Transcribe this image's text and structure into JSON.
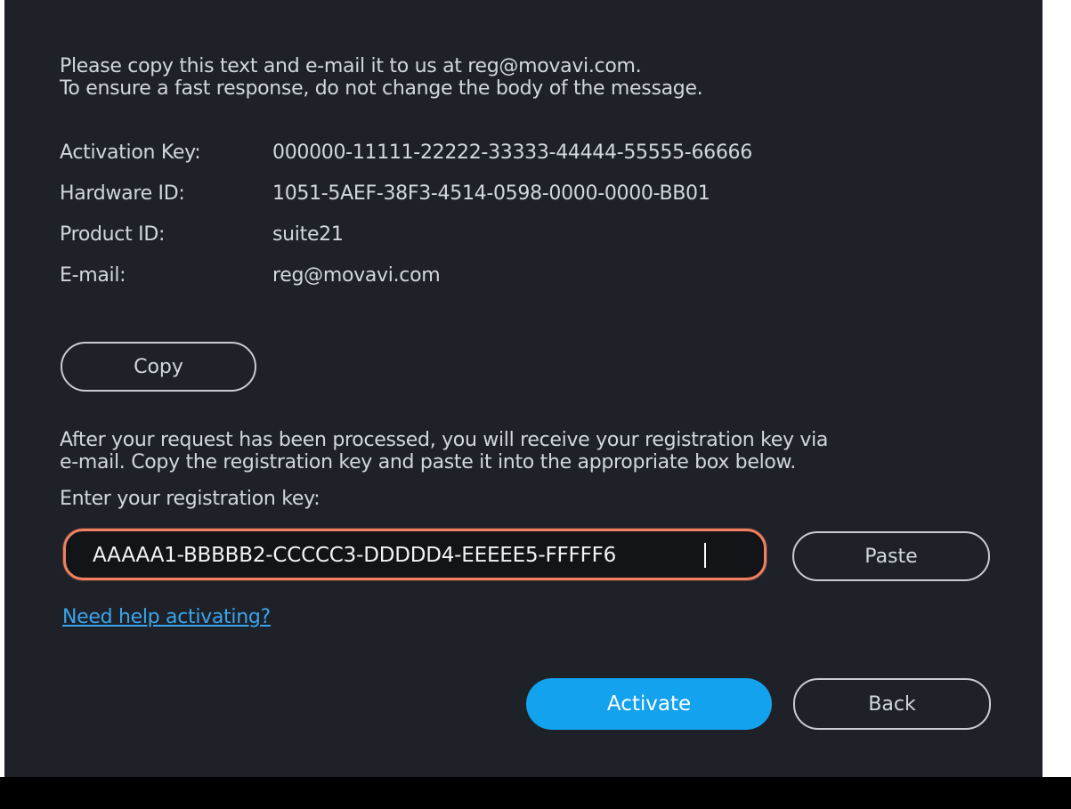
{
  "intro": {
    "line1": "Please copy this text and e-mail it to us at reg@movavi.com.",
    "line2": "To ensure a fast response, do not change the body of the message."
  },
  "details": [
    {
      "label": "Activation Key:",
      "value": "000000-11111-22222-33333-44444-55555-66666"
    },
    {
      "label": "Hardware ID:",
      "value": "1051-5AEF-38F3-4514-0598-0000-0000-BB01"
    },
    {
      "label": "Product ID:",
      "value": "suite21"
    },
    {
      "label": "E-mail:",
      "value": "reg@movavi.com"
    }
  ],
  "copy_button": "Copy",
  "after_request": {
    "line1": "After your request has been processed, you will receive your registration key via",
    "line2": "e-mail. Copy the registration key and paste it into the appropriate box below."
  },
  "enter_label": "Enter your registration key:",
  "registration_input": {
    "value": "AAAAA1-BBBBB2-CCCCC3-DDDDD4-EEEEE5-FFFFF6"
  },
  "paste_button": "Paste",
  "help_link": "Need help activating?",
  "activate_button": "Activate",
  "back_button": "Back",
  "colors": {
    "dialog_bg": "#1e2128",
    "text": "#d2d6de",
    "accent": "#12a2ee",
    "link": "#3aa5ec",
    "input_focus_border": "#f0805f"
  }
}
